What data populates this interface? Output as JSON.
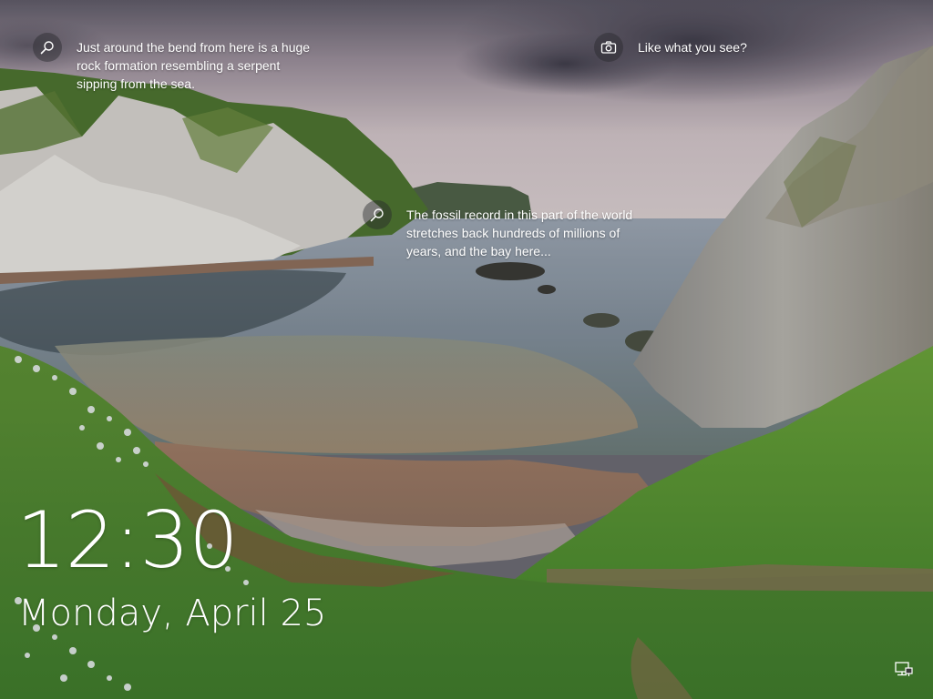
{
  "screen": {
    "type": "lock-screen"
  },
  "hotspots": [
    {
      "icon": "search-icon",
      "text": "Just around the bend from here is a huge\nrock formation resembling a serpent\nsipping from the sea."
    },
    {
      "icon": "search-icon",
      "text": "The fossil record in this part of the world\nstretches back hundreds of millions of\nyears, and the bay here..."
    }
  ],
  "like_prompt": {
    "icon": "camera-icon",
    "text": "Like what you see?"
  },
  "clock": {
    "time": "12:30",
    "date": "Monday, April 25"
  },
  "system_tray": {
    "network_icon": "network-icon"
  },
  "colors": {
    "sky_top": "#6e6a78",
    "sky_light": "#cbbdc2",
    "sea": "#8a96a6",
    "grass": "#5f9a3a",
    "cliff": "#a3a29c",
    "text": "#ffffff"
  }
}
